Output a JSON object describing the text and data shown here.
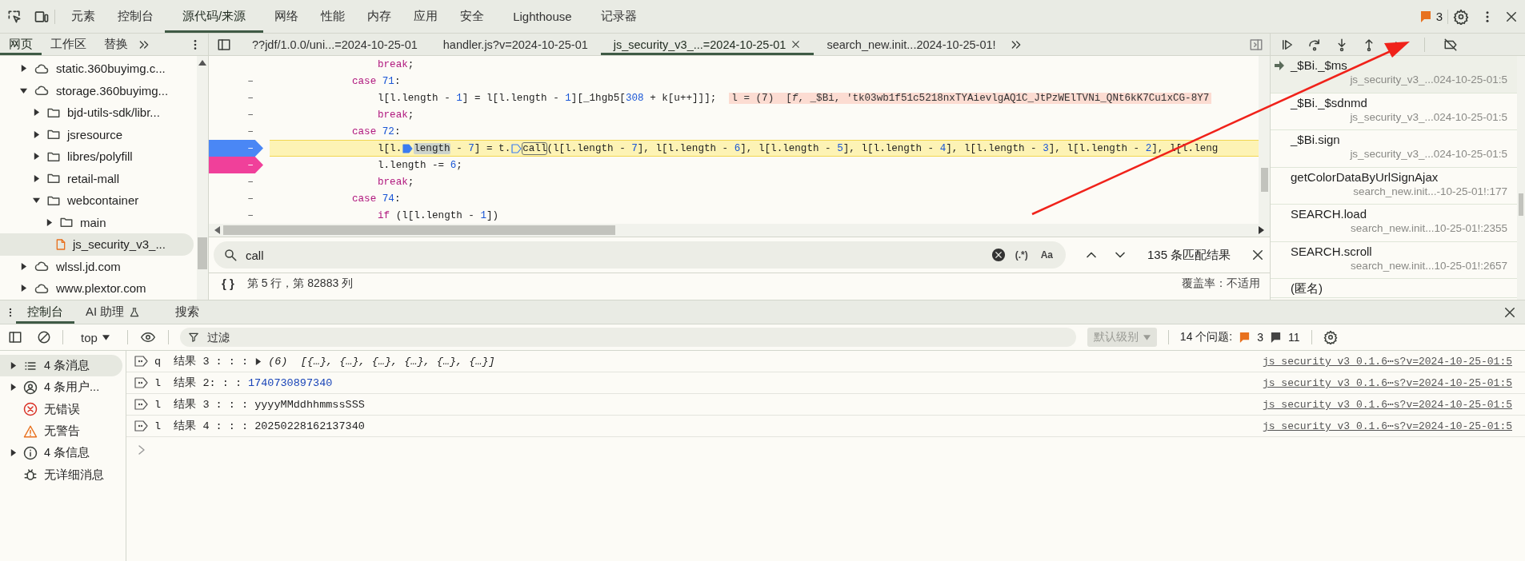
{
  "top_tabs": [
    {
      "label": "元素",
      "selected": false
    },
    {
      "label": "控制台",
      "selected": false
    },
    {
      "label": "源代码/来源",
      "selected": true
    },
    {
      "label": "网络",
      "selected": false
    },
    {
      "label": "性能",
      "selected": false
    },
    {
      "label": "内存",
      "selected": false
    },
    {
      "label": "应用",
      "selected": false
    },
    {
      "label": "安全",
      "selected": false
    },
    {
      "label": "Lighthouse",
      "selected": false
    },
    {
      "label": "记录器",
      "selected": false
    }
  ],
  "issues_count": "3",
  "navigator": {
    "tabs": [
      {
        "label": "网页",
        "selected": true
      },
      {
        "label": "工作区",
        "selected": false
      },
      {
        "label": "替换",
        "selected": false
      }
    ],
    "tree": [
      {
        "label": "static.360buyimg.c...",
        "kind": "domain",
        "expanded": false,
        "selected": false
      },
      {
        "label": "storage.360buyimg...",
        "kind": "domain",
        "expanded": true,
        "selected": false,
        "children": [
          {
            "label": "bjd-utils-sdk/libr...",
            "kind": "folder",
            "expanded": false,
            "selected": false
          },
          {
            "label": "jsresource",
            "kind": "folder",
            "expanded": false,
            "selected": false
          },
          {
            "label": "libres/polyfill",
            "kind": "folder",
            "expanded": false,
            "selected": false
          },
          {
            "label": "retail-mall",
            "kind": "folder",
            "expanded": false,
            "selected": false
          },
          {
            "label": "webcontainer",
            "kind": "folder",
            "expanded": true,
            "selected": false,
            "children": [
              {
                "label": "main",
                "kind": "folder",
                "expanded": false,
                "selected": false
              },
              {
                "label": "js_security_v3_...",
                "kind": "file",
                "selected": true
              }
            ]
          }
        ]
      },
      {
        "label": "wlssl.jd.com",
        "kind": "domain",
        "expanded": false,
        "selected": false
      },
      {
        "label": "www.plextor.com",
        "kind": "domain",
        "expanded": false,
        "selected": false
      }
    ]
  },
  "editor_tabs": [
    {
      "label": "??jdf/1.0.0/uni...=2024-10-25-01",
      "selected": false
    },
    {
      "label": "handler.js?v=2024-10-25-01",
      "selected": false
    },
    {
      "label": "js_security_v3_...=2024-10-25-01",
      "selected": true
    },
    {
      "label": "search_new.init...2024-10-25-01!",
      "selected": false
    }
  ],
  "code_lines": [
    {
      "kind": "stmt",
      "breakpoint": false,
      "logpoint": false,
      "highlighted": false,
      "parts": [
        {
          "text": "**break**;"
        }
      ]
    },
    {
      "kind": "case",
      "gutter": "–",
      "breakpoint": false,
      "logpoint": false,
      "highlighted": false,
      "parts": [
        {
          "text": "**case** *71*:"
        }
      ]
    },
    {
      "kind": "stmt",
      "gutter": "–",
      "breakpoint": false,
      "logpoint": false,
      "highlighted": false,
      "parts": [
        {
          "text": "l[l.length - *1*] = l[l.length - *1*][_1hgb5[*308* + k[u++]]];"
        }
      ],
      "inline_value": "l = (7)  [*f*, _$Bi, 'tk03wb1f51c5218nxTYAievlgAQ1C_JtPzWElTVNi_QNt6kK7Cu1xCG-8Y7"
    },
    {
      "kind": "stmt",
      "gutter": "–",
      "breakpoint": false,
      "logpoint": false,
      "highlighted": false,
      "parts": [
        {
          "text": "**break**;"
        }
      ]
    },
    {
      "kind": "case",
      "gutter": "–",
      "breakpoint": false,
      "logpoint": false,
      "highlighted": false,
      "parts": [
        {
          "text": "**case** *72*:"
        }
      ]
    },
    {
      "kind": "stmt",
      "gutter": "–",
      "breakpoint": true,
      "logpoint": false,
      "highlighted": true,
      "parts": [
        {
          "text": "l[l.",
          "marker": false,
          "selected": false,
          "match": false
        },
        {
          "text": "length",
          "marker": true,
          "filled": true,
          "selected": true,
          "match": false
        },
        {
          "text": " - *7*] = t.",
          "marker": false,
          "selected": false,
          "match": false
        },
        {
          "text": "call",
          "marker": true,
          "filled": false,
          "selected": false,
          "match": true
        },
        {
          "text": "(l[l.length - *7*], l[l.length - *6*], l[l.length - *5*], l[l.length - *4*], l[l.length - *3*], l[l.length - *2*], l[l.leng",
          "marker": false,
          "selected": false,
          "match": false
        }
      ]
    },
    {
      "kind": "stmt",
      "gutter": "–",
      "breakpoint": false,
      "logpoint": true,
      "highlighted": false,
      "parts": [
        {
          "text": "l.length -= *6*;"
        }
      ]
    },
    {
      "kind": "stmt",
      "gutter": "–",
      "breakpoint": false,
      "logpoint": false,
      "highlighted": false,
      "parts": [
        {
          "text": "**break**;"
        }
      ]
    },
    {
      "kind": "case",
      "gutter": "–",
      "breakpoint": false,
      "logpoint": false,
      "highlighted": false,
      "parts": [
        {
          "text": "**case** *74*:"
        }
      ]
    },
    {
      "kind": "stmt",
      "gutter": "–",
      "breakpoint": false,
      "logpoint": false,
      "highlighted": false,
      "parts": [
        {
          "text": "**if** (l[l.length - *1*])"
        }
      ]
    }
  ],
  "search": {
    "value": "call",
    "regex_label": "(.*)",
    "case_label": "Aa",
    "matches": "135 条匹配结果"
  },
  "status": {
    "pretty_print": "{ }",
    "position": "第 5 行，第 82883 列",
    "coverage": "覆盖率：不适用"
  },
  "call_stack": [
    {
      "name": "_$Bi._$ms",
      "location": "js_security_v3_...024-10-25-01:5",
      "selected": true
    },
    {
      "name": "_$Bi._$sdnmd",
      "location": "js_security_v3_...024-10-25-01:5",
      "selected": false
    },
    {
      "name": "_$Bi.sign",
      "location": "js_security_v3_...024-10-25-01:5",
      "selected": false
    },
    {
      "name": "getColorDataByUrlSignAjax",
      "location": "search_new.init...-10-25-01!:177",
      "selected": false
    },
    {
      "name": "SEARCH.load",
      "location": "search_new.init...10-25-01!:2355",
      "selected": false
    },
    {
      "name": "SEARCH.scroll",
      "location": "search_new.init...10-25-01!:2657",
      "selected": false
    },
    {
      "name": "(匿名)",
      "selected": false
    }
  ],
  "drawer_tabs": [
    {
      "label": "控制台",
      "kind": "plain",
      "selected": true
    },
    {
      "label": "AI 助理",
      "kind": "experiment",
      "selected": false
    },
    {
      "label": "搜索",
      "kind": "plain",
      "selected": false
    }
  ],
  "console_toolbar": {
    "context": "top",
    "filter_placeholder": "过滤",
    "level": "默认级别",
    "issues_label": "14 个问题:",
    "issue_count": "3",
    "message_count": "11"
  },
  "console_sidebar": [
    {
      "label": "4 条消息",
      "kind": "messages",
      "collapsible": true,
      "selected": true
    },
    {
      "label": "4 条用户...",
      "kind": "user",
      "collapsible": true,
      "selected": false
    },
    {
      "label": "无错误",
      "kind": "error",
      "collapsible": false,
      "selected": false
    },
    {
      "label": "无警告",
      "kind": "warning",
      "collapsible": false,
      "selected": false
    },
    {
      "label": "4 条信息",
      "kind": "info",
      "collapsible": true,
      "selected": false
    },
    {
      "label": "无详细消息",
      "kind": "verbose",
      "collapsible": false,
      "selected": false
    }
  ],
  "console_messages": [
    {
      "text": "q  结果 3 : : :",
      "kind": "object",
      "value": "(6)  [{…}, {…}, {…}, {…}, {…}, {…}]",
      "source": "js_security_v3_0.1.6⋯s?v=2024-10-25-01:5"
    },
    {
      "text": "l  结果 2: : :",
      "kind": "number",
      "value": "1740730897340",
      "source": "js_security_v3_0.1.6⋯s?v=2024-10-25-01:5"
    },
    {
      "text": "l  结果 3 : : :",
      "kind": "string",
      "value": "yyyyMMddhhmmssSSS",
      "source": "js_security_v3_0.1.6⋯s?v=2024-10-25-01:5"
    },
    {
      "text": "l  结果 4 : : :",
      "kind": "string",
      "value": "20250228162137340",
      "source": "js_security_v3_0.1.6⋯s?v=2024-10-25-01:5"
    }
  ]
}
